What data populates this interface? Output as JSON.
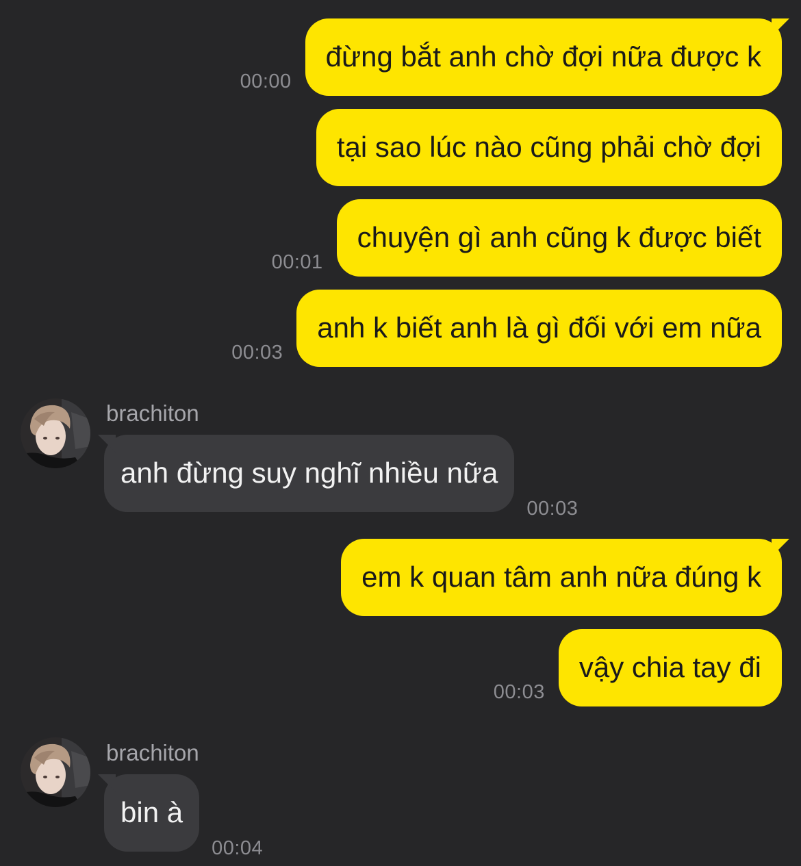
{
  "messages": [
    {
      "text": "đừng bắt anh chờ đợi nữa được k",
      "time": "00:00"
    },
    {
      "text": "tại sao lúc nào cũng phải chờ đợi",
      "time": ""
    },
    {
      "text": "chuyện gì anh cũng k được biết",
      "time": "00:01"
    },
    {
      "text": "anh k biết anh là gì đối với em nữa",
      "time": "00:03"
    },
    {
      "sender": "brachiton",
      "text": "anh đừng suy nghĩ nhiều nữa",
      "time": "00:03"
    },
    {
      "text": "em k quan tâm anh nữa đúng k",
      "time": ""
    },
    {
      "text": "vậy chia tay đi",
      "time": "00:03"
    },
    {
      "sender": "brachiton",
      "text": "bin à",
      "time": "00:04"
    }
  ],
  "colors": {
    "background": "#262628",
    "outgoing_bubble": "#fee500",
    "incoming_bubble": "#3b3b3e",
    "timestamp": "#8d8d92"
  }
}
